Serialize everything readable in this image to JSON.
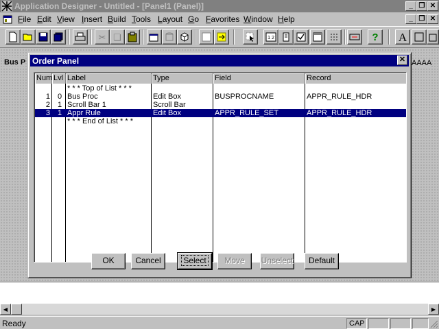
{
  "app": {
    "title": "Application Designer - Untitled - [Panel1 (Panel)]"
  },
  "menu": [
    "File",
    "Edit",
    "View",
    "Insert",
    "Build",
    "Tools",
    "Layout",
    "Go",
    "Favorites",
    "Window",
    "Help"
  ],
  "toolbar": {
    "text_label": "A"
  },
  "workspace": {
    "left_label": "Bus P",
    "right_label": "AAAA"
  },
  "dialog": {
    "title": "Order Panel",
    "columns": [
      "Num",
      "Lvl",
      "Label",
      "Type",
      "Field",
      "Record"
    ],
    "rows": [
      {
        "num": "",
        "lvl": "",
        "label": "* * * Top of List * * *",
        "type": "",
        "field": "",
        "record": "",
        "selected": false
      },
      {
        "num": "1",
        "lvl": "0",
        "label": "Bus Proc",
        "type": "Edit Box",
        "field": "BUSPROCNAME",
        "record": "APPR_RULE_HDR",
        "selected": false
      },
      {
        "num": "2",
        "lvl": "1",
        "label": "Scroll Bar 1",
        "type": "Scroll Bar",
        "field": "",
        "record": "",
        "selected": false
      },
      {
        "num": "3",
        "lvl": "1",
        "label": "Appr Rule",
        "type": "Edit Box",
        "field": "APPR_RULE_SET",
        "record": "APPR_RULE_HDR",
        "selected": true
      },
      {
        "num": "",
        "lvl": "",
        "label": "* * * End of List * * *",
        "type": "",
        "field": "",
        "record": "",
        "selected": false
      }
    ],
    "buttons": {
      "ok": "OK",
      "cancel": "Cancel",
      "select": "Select",
      "move": "Move",
      "unselect": "Unselect",
      "default": "Default"
    }
  },
  "status": {
    "text": "Ready",
    "cap": "CAP"
  },
  "colors": {
    "selection": "#000080",
    "face": "#c0c0c0"
  }
}
